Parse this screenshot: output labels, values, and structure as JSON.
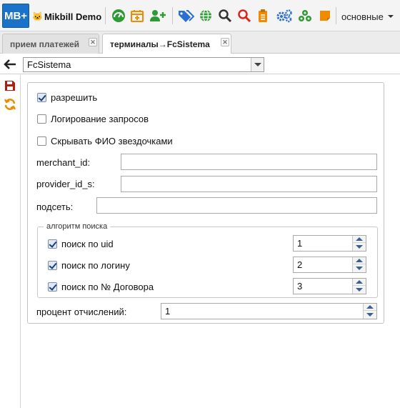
{
  "app": {
    "logo_text": "MB+",
    "brand_name": "Mikbill Demo",
    "menu_label": "основные"
  },
  "toolbar_icons": [
    "dashboard-icon",
    "calendar-add-icon",
    "add-user-icon",
    "tags-icon",
    "globe-icon",
    "search-icon",
    "search-red-icon",
    "clipboard-icon",
    "settings-icon",
    "network-icon",
    "note-icon"
  ],
  "colors": {
    "logo_bg": "#1a73c8",
    "green": "#2e9a34",
    "orange": "#f08a00",
    "blue": "#2b6fd1",
    "red": "#d9261c"
  },
  "tabs": [
    {
      "label": "прием платежей",
      "active": false
    },
    {
      "label": "терминалы→FcSistema",
      "active": true
    }
  ],
  "terminal_select": {
    "value": "FcSistema"
  },
  "form": {
    "allow": {
      "label": "разрешить",
      "checked": true
    },
    "log_requests": {
      "label": "Логирование запросов",
      "checked": false
    },
    "hide_fio": {
      "label": "Скрывать ФИО звездочками",
      "checked": false
    },
    "merchant_id": {
      "label": "merchant_id:",
      "value": ""
    },
    "provider_id_s": {
      "label": "provider_id_s:",
      "value": ""
    },
    "subnet": {
      "label": "подсеть:",
      "value": ""
    },
    "search_algo": {
      "legend": "алгоритм поиска",
      "items": [
        {
          "label": "поиск по uid",
          "checked": true,
          "priority": "1"
        },
        {
          "label": "поиск по логину",
          "checked": true,
          "priority": "2"
        },
        {
          "label": "поиск по № Договора",
          "checked": true,
          "priority": "3"
        }
      ]
    },
    "percent": {
      "label": "процент отчислений:",
      "value": "1"
    }
  }
}
